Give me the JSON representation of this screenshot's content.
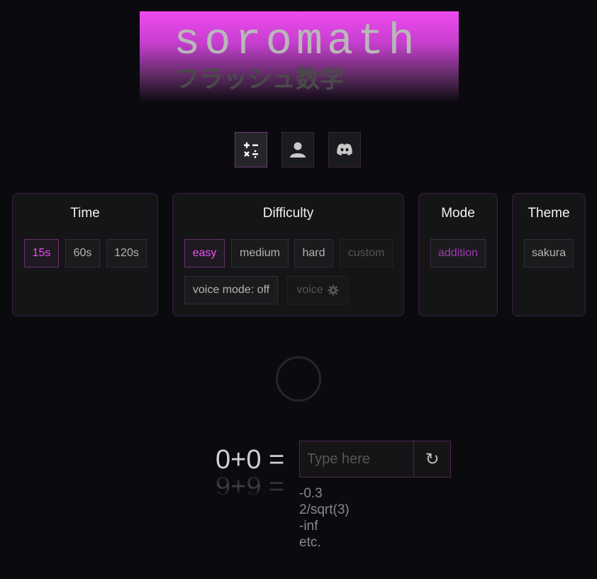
{
  "banner": {
    "title": "soromath",
    "subtitle": "フラッシュ数学"
  },
  "nav": [
    {
      "icon": "calculator-icon",
      "active": true
    },
    {
      "icon": "user-icon",
      "active": false
    },
    {
      "icon": "discord-icon",
      "active": false
    }
  ],
  "time": {
    "title": "Time",
    "options": [
      "15s",
      "60s",
      "120s"
    ],
    "selected": "15s"
  },
  "difficulty": {
    "title": "Difficulty",
    "options": [
      "easy",
      "medium",
      "hard",
      "custom"
    ],
    "selected": "easy",
    "voice_mode": "voice mode: off",
    "voice_label": "voice"
  },
  "mode": {
    "title": "Mode",
    "options": [
      "addition"
    ],
    "selected": "addition"
  },
  "theme": {
    "title": "Theme",
    "options": [
      "sakura"
    ]
  },
  "problem": {
    "current": "0+0 =",
    "next": "9+9 ="
  },
  "answer": {
    "placeholder": "Type here",
    "reset_symbol": "↻"
  },
  "hints": [
    "-0.3",
    "2/sqrt(3)",
    "-inf",
    "etc."
  ],
  "colors": {
    "accent": "#ee4cf0",
    "background": "#0b0a0f",
    "panel": "#151517",
    "border": "#3c1e46"
  }
}
